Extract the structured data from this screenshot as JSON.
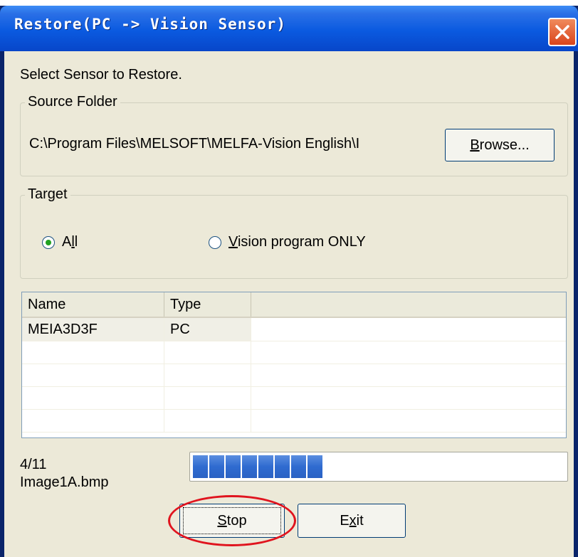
{
  "caption": "The screenshot is cut off at the top.",
  "window": {
    "title": "Restore(PC -> Vision Sensor)"
  },
  "instruction": "Select Sensor to Restore.",
  "source_folder": {
    "label": "Source Folder",
    "path": "C:\\Program Files\\MELSOFT\\MELFA-Vision English\\I",
    "browse_label": "Browse..."
  },
  "target": {
    "label": "Target",
    "all_label": "All",
    "vision_label": "Vision program ONLY",
    "selected": "All"
  },
  "list": {
    "columns": [
      "Name",
      "Type",
      ""
    ],
    "rows": [
      {
        "name": "MEIA3D3F",
        "type": "PC"
      }
    ]
  },
  "progress": {
    "count": "4/11",
    "file": "Image1A.bmp",
    "fraction": 0.364
  },
  "buttons": {
    "stop_label": "Stop",
    "exit_label": "Exit"
  },
  "colors": {
    "highlight": "#e0141e",
    "progress_fill": "#2f6bd0",
    "titlebar": "#0a5ae0"
  },
  "icons": {
    "close": "close-x-icon"
  }
}
